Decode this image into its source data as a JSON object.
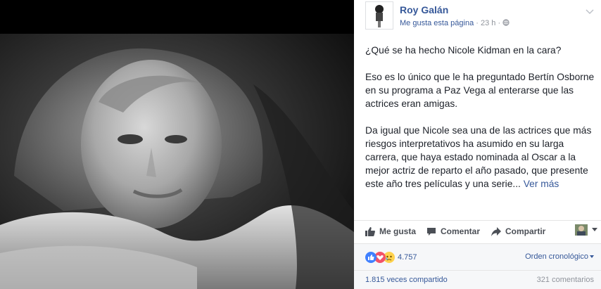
{
  "post": {
    "author": "Roy Galán",
    "liked_page": "Me gusta esta página",
    "separator": " · ",
    "time": "23 h",
    "paragraphs": [
      "¿Qué se ha hecho Nicole Kidman en la cara?",
      "Eso es lo único que le ha preguntado Bertín Osborne en su programa a Paz Vega al enterarse que las actrices eran amigas.",
      "Da igual que Nicole sea una de las actrices que más riesgos interpretativos ha asumido en su larga carrera, que haya estado nominada al Oscar a la mejor actriz de reparto el año pasado, que presente este año tres películas y una serie..."
    ],
    "see_more": "Ver más"
  },
  "actions": {
    "like": "Me gusta",
    "comment": "Comentar",
    "share": "Compartir"
  },
  "reactions": {
    "count": "4.757",
    "sort": "Orden cronológico",
    "types": [
      "like-icon",
      "love-icon",
      "sad-icon"
    ]
  },
  "stats": {
    "shares": "1.815 veces compartido",
    "comments": "321 comentarios"
  },
  "colors": {
    "link": "#365899",
    "like_blue": "#4080ff",
    "love_red": "#f25268",
    "sad_yellow": "#ffd24d"
  }
}
